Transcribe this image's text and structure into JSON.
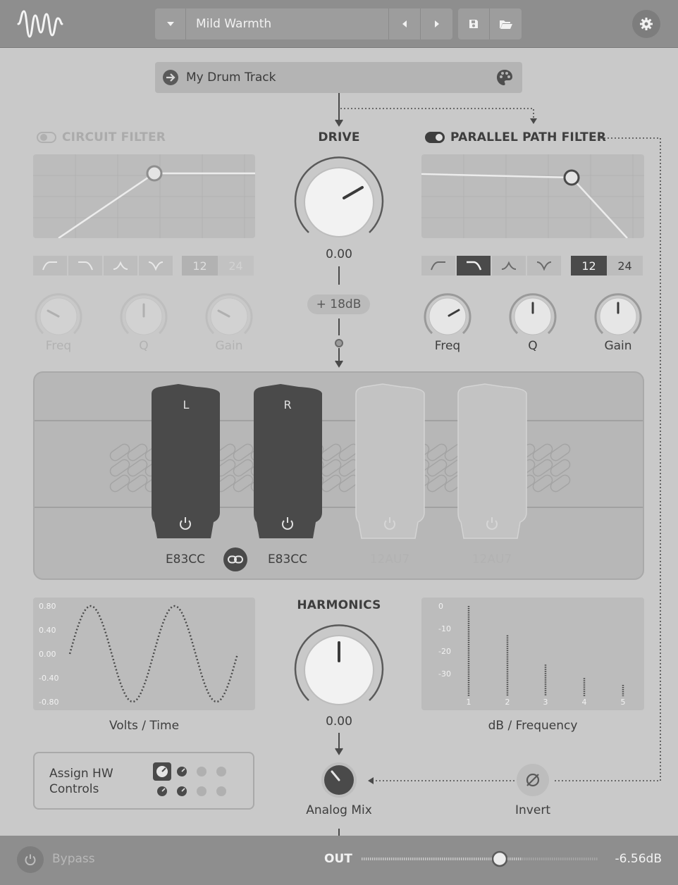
{
  "header": {
    "preset_name": "Mild Warmth",
    "icons": [
      "logo-wave-icon",
      "chevron-down-icon",
      "prev-arrow-icon",
      "next-arrow-icon",
      "save-icon",
      "folder-open-icon",
      "gear-icon"
    ]
  },
  "track": {
    "name": "My Drum Track",
    "icons": [
      "arrow-right-circle-icon",
      "palette-icon"
    ]
  },
  "circuit_filter": {
    "title": "CIRCUIT FILTER",
    "enabled": false,
    "slopes": [
      "12",
      "24"
    ],
    "knobs": [
      {
        "label": "Freq"
      },
      {
        "label": "Q"
      },
      {
        "label": "Gain"
      }
    ]
  },
  "drive": {
    "title": "DRIVE",
    "value": "0.00",
    "boost_label": "+ 18dB"
  },
  "parallel_filter": {
    "title": "PARALLEL PATH FILTER",
    "enabled": true,
    "slopes": [
      "12",
      "24"
    ],
    "knobs": [
      {
        "label": "Freq"
      },
      {
        "label": "Q"
      },
      {
        "label": "Gain"
      }
    ]
  },
  "tubes": [
    {
      "top_label": "L",
      "name": "E83CC",
      "active": true
    },
    {
      "top_label": "R",
      "name": "E83CC",
      "active": true
    },
    {
      "top_label": "",
      "name": "12AU7",
      "active": false
    },
    {
      "top_label": "",
      "name": "12AU7",
      "active": false
    }
  ],
  "volts_graph": {
    "caption": "Volts / Time",
    "y_ticks": [
      "0.80",
      "0.40",
      "0.00",
      "-0.40",
      "-0.80"
    ]
  },
  "harmonics": {
    "title": "HARMONICS",
    "value": "0.00"
  },
  "db_graph": {
    "caption": "dB / Frequency",
    "y_ticks": [
      "0",
      "-10",
      "-20",
      "-30"
    ],
    "x_ticks": [
      "1",
      "2",
      "3",
      "4",
      "5"
    ]
  },
  "hw": {
    "line1": "Assign HW",
    "line2": "Controls"
  },
  "mix": {
    "label": "Analog Mix"
  },
  "invert": {
    "label": "Invert"
  },
  "footer": {
    "bypass_label": "Bypass",
    "out_label": "OUT",
    "out_value": "-6.56dB"
  },
  "chart_data": [
    {
      "type": "line",
      "title": "",
      "xlabel": "Volts / Time",
      "ylabel": "",
      "ylim": [
        -0.8,
        0.8
      ],
      "y_ticks": [
        0.8,
        0.4,
        0.0,
        -0.4,
        -0.8
      ],
      "series": [
        {
          "values": [
            0.0,
            0.8,
            0.0,
            -0.8,
            0.0,
            0.8,
            0.0,
            -0.8,
            0.0
          ]
        }
      ],
      "grid": false
    },
    {
      "type": "bar",
      "title": "",
      "xlabel": "dB / Frequency",
      "ylabel": "",
      "categories": [
        "1",
        "2",
        "3",
        "4",
        "5"
      ],
      "values": [
        0,
        -13,
        -26,
        -32,
        -35
      ],
      "y_ticks": [
        0,
        -10,
        -20,
        -30
      ],
      "grid": false
    }
  ]
}
